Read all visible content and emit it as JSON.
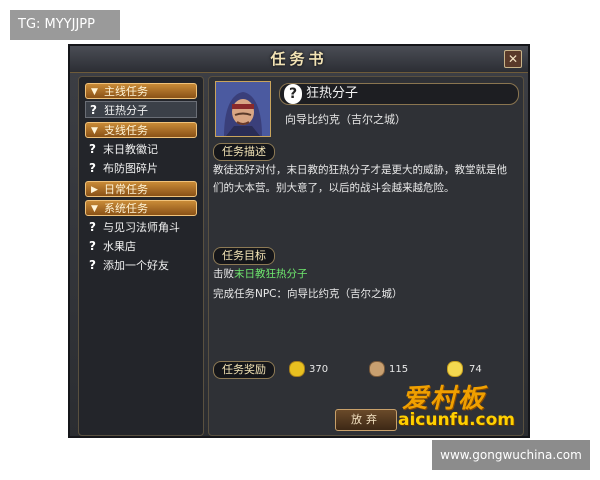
{
  "watermarks": {
    "top_left_tag": "TG: MYYJJPP",
    "bottom_right_site": "www.gongwuchina.com",
    "logo_cn": "爱村板",
    "logo_en": "aicunfu.com"
  },
  "window": {
    "title": "任务书",
    "close_symbol": "✕"
  },
  "sidebar": {
    "categories": [
      {
        "label": "主线任务"
      },
      {
        "label": "支线任务"
      },
      {
        "label": "日常任务"
      },
      {
        "label": "系统任务"
      }
    ],
    "items": [
      {
        "label": "狂热分子"
      },
      {
        "label": "末日教徽记"
      },
      {
        "label": "布防图碎片"
      },
      {
        "label": "与见习法师角斗"
      },
      {
        "label": "水果店"
      },
      {
        "label": "添加一个好友"
      }
    ],
    "question_mark": "?"
  },
  "detail": {
    "quest_name": "狂热分子",
    "quest_giver": "向导比约克（吉尔之城）",
    "description_header": "任务描述",
    "description": "教徒还好对付，末日教的狂热分子才是更大的威胁，教堂就是他们的大本营。别大意了，以后的战斗会越来越危险。",
    "goal_header": "任务目标",
    "goal_prefix": "击败",
    "goal_target": "末日教狂热分子",
    "goal_completion": "完成任务NPC：向导比约克（吉尔之城）",
    "reward_header": "任务奖励",
    "rewards": {
      "gold": "370",
      "exp": "115",
      "other": "74"
    },
    "abandon_label": "放弃"
  }
}
